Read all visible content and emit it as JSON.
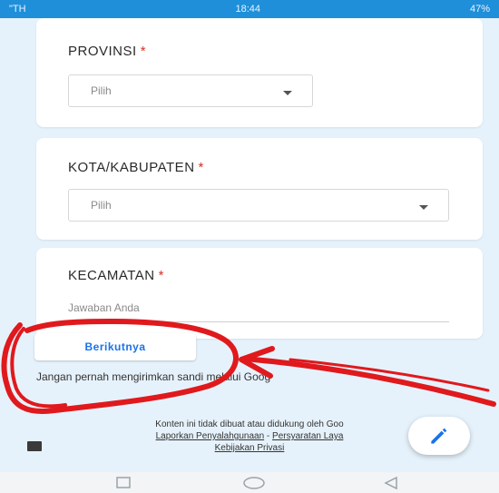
{
  "status_bar": {
    "carrier": "\"TH",
    "time": "18:44",
    "battery": "47%"
  },
  "form": {
    "provinsi": {
      "label": "PROVINSI",
      "required_mark": "*",
      "value": "Pilih"
    },
    "kota": {
      "label": "KOTA/KABUPATEN",
      "required_mark": "*",
      "value": "Pilih"
    },
    "kecamatan": {
      "label": "KECAMATAN",
      "required_mark": "*",
      "placeholder": "Jawaban Anda"
    },
    "next_label": "Berikutnya"
  },
  "warning_text": "Jangan pernah mengirimkan sandi melalui Goog",
  "footer": {
    "disclaimer": "Konten ini tidak dibuat atau didukung oleh Goo",
    "report_link": "Laporkan Penyalahgunaan",
    "separator": "-",
    "terms_link": "Persyaratan Laya",
    "privacy_link": "Kebijakan Privasi"
  },
  "colors": {
    "status_bar": "#1f8fd9",
    "accent": "#1a73e8",
    "required": "#d93025",
    "annotation": "#e0191d",
    "background": "#e6f2fb"
  },
  "icons": {
    "report": "report-icon",
    "edit": "pencil-icon",
    "nav": [
      "recent-apps-icon",
      "home-icon",
      "back-icon"
    ]
  }
}
